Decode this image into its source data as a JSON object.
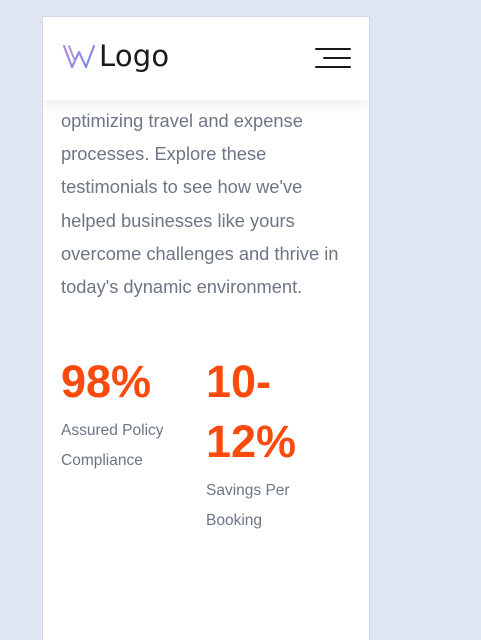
{
  "header": {
    "logo_text": "Logo",
    "logo_icon": "w-brand-mark-icon",
    "menu_icon": "hamburger-menu-icon"
  },
  "intro": {
    "text": "optimizing travel and expense processes. Explore these testimonials to see how we've helped businesses like yours overcome challenges and thrive in today's dynamic environment."
  },
  "stats": [
    {
      "value": "98%",
      "label": "Assured Policy Compliance"
    },
    {
      "value": "10-12%",
      "label": "Savings Per Booking"
    }
  ],
  "colors": {
    "accent": "#fa4a0c",
    "body_text": "#6c7684",
    "background": "#dfe5f3",
    "card": "#ffffff"
  }
}
